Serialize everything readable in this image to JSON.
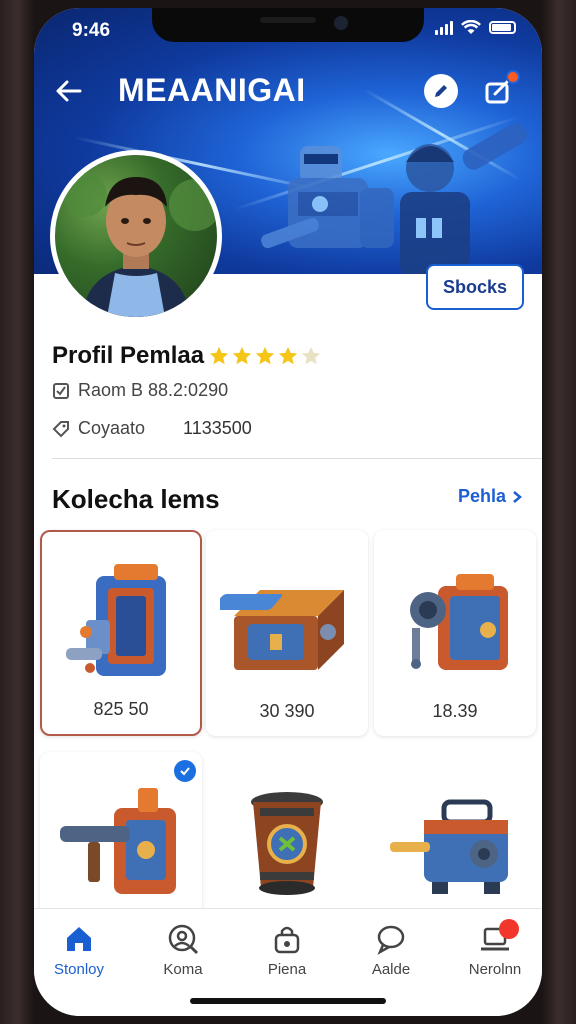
{
  "status_bar": {
    "time": "9:46"
  },
  "header": {
    "title": "MEAANIGAI"
  },
  "actions": {
    "stocks_label": "Sbocks"
  },
  "profile": {
    "name": "Profil Pemlaa",
    "rating_stars": 4,
    "row1_text": "Raom B 88.2:0290",
    "row2_label": "Coyaato",
    "row2_value": "1133500"
  },
  "collection": {
    "title": "Kolecha lems",
    "see_all_label": "Pehla",
    "items": [
      {
        "price": "825 50"
      },
      {
        "price": "30 390"
      },
      {
        "price": "18.39"
      },
      {
        "price": ""
      },
      {
        "price": ""
      },
      {
        "price": ""
      }
    ]
  },
  "bottom_nav": {
    "items": [
      {
        "label": "Stonloy",
        "icon": "home-icon"
      },
      {
        "label": "Koma",
        "icon": "user-search-icon"
      },
      {
        "label": "Piena",
        "icon": "bag-icon"
      },
      {
        "label": "Aalde",
        "icon": "chat-icon"
      },
      {
        "label": "Nerolnn",
        "icon": "laptop-icon"
      }
    ]
  },
  "colors": {
    "accent": "#1a5fd1",
    "hero_dark": "#0a2670",
    "hero_light": "#4aa8ff",
    "notification": "#ff5a1f"
  }
}
